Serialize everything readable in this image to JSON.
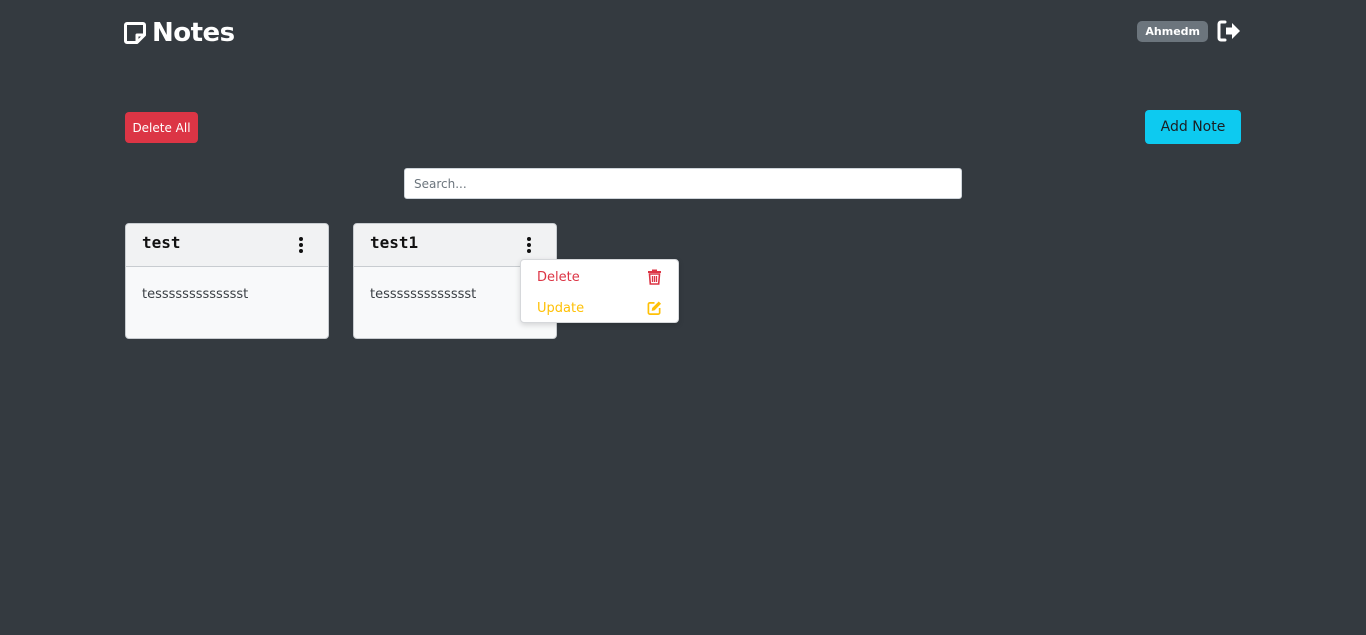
{
  "header": {
    "brand_label": "Notes",
    "username": "Ahmedm"
  },
  "actions": {
    "delete_all_label": "Delete All",
    "add_note_label": "Add Note"
  },
  "search": {
    "placeholder": "Search..."
  },
  "notes": [
    {
      "title": "test",
      "body": "tessssssssssssst"
    },
    {
      "title": "test1",
      "body": "tessssssssssssst"
    }
  ],
  "menu": {
    "delete_label": "Delete",
    "update_label": "Update"
  },
  "colors": {
    "background": "#343a40",
    "danger": "#dc3545",
    "info": "#0dcaf0",
    "warning": "#ffc107",
    "badge": "#6c757d"
  }
}
